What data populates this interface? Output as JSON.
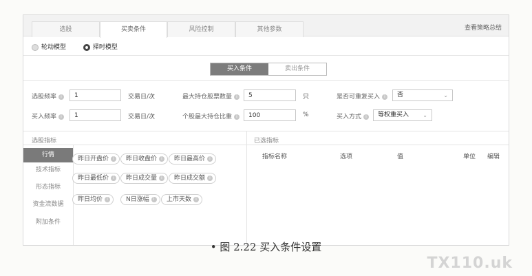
{
  "tabs": [
    "选股",
    "买卖条件",
    "风险控制",
    "其他参数"
  ],
  "summary_link": "查看策略总结",
  "modes": [
    "轮动模型",
    "择时模型"
  ],
  "switch": {
    "buy": "买入条件",
    "sell": "卖出条件"
  },
  "form": {
    "pick_freq_label": "选股频率",
    "pick_freq_value": "1",
    "pick_freq_unit": "交易日/次",
    "max_hold_label": "最大持仓股票数量",
    "max_hold_value": "5",
    "max_hold_unit": "只",
    "repeat_label": "是否可重复买入",
    "repeat_value": "否",
    "buy_freq_label": "买入频率",
    "buy_freq_value": "1",
    "buy_freq_unit": "交易日/次",
    "max_ratio_label": "个股最大持仓比重",
    "max_ratio_value": "100",
    "max_ratio_unit": "%",
    "buy_method_label": "买入方式",
    "buy_method_value": "等权重买入"
  },
  "indicator_title": "选股指标",
  "selected_title": "已选指标",
  "categories": [
    "行情",
    "技术指标",
    "形态指标",
    "资金流数据",
    "附加条件"
  ],
  "chips": [
    "昨日开盘价",
    "昨日收盘价",
    "昨日最高价",
    "昨日最低价",
    "昨日成交量",
    "昨日成交额",
    "昨日均价",
    "N日涨幅",
    "上市天数"
  ],
  "table_headers": [
    "指标名称",
    "选项",
    "值",
    "单位",
    "编辑"
  ],
  "caption": "• 图 2.22   买入条件设置",
  "watermark": "TX110.uk"
}
